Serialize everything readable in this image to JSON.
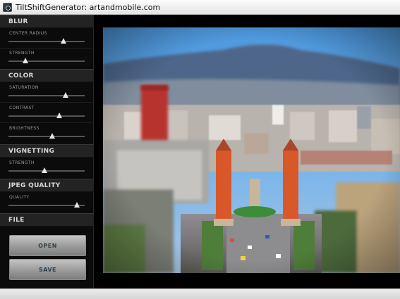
{
  "window": {
    "title": "TiltShiftGenerator: artandmobile.com"
  },
  "sections": {
    "blur": "BLUR",
    "color": "COLOR",
    "vignetting": "VIGNETTING",
    "jpeg_quality": "JPEG QUALITY",
    "file": "FILE"
  },
  "sliders": {
    "center_radius": {
      "label": "CENTER RADIUS",
      "value": 0.72
    },
    "blur_strength": {
      "label": "STRENGTH",
      "value": 0.22
    },
    "saturation": {
      "label": "SATURATION",
      "value": 0.75
    },
    "contrast": {
      "label": "CONTRAST",
      "value": 0.67
    },
    "brightness": {
      "label": "BRIGHTNESS",
      "value": 0.57
    },
    "vignetting_strength": {
      "label": "STRENGTH",
      "value": 0.47
    },
    "quality": {
      "label": "QUALITY",
      "value": 0.9
    }
  },
  "buttons": {
    "open": "OPEN",
    "save": "SAVE"
  },
  "colors": {
    "sidebar_bg": "#0b0b0b",
    "section_header_bg": "#232323",
    "sky": "#5aa3e0",
    "tower": "#d8582a"
  },
  "icons": {
    "app": "tilt-shift-app-icon"
  }
}
